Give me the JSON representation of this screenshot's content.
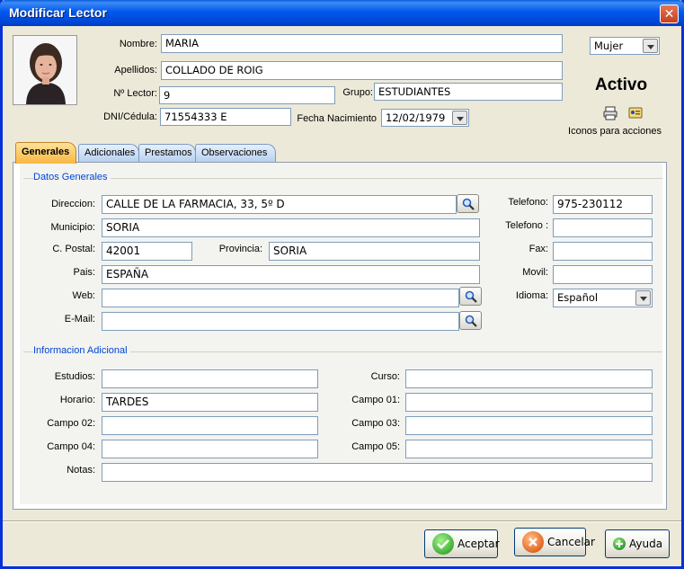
{
  "window": {
    "title": "Modificar Lector",
    "close_glyph": "✕"
  },
  "header": {
    "nombre_label": "Nombre:",
    "nombre_value": "MARIA",
    "apellidos_label": "Apellidos:",
    "apellidos_value": "COLLADO DE ROIG",
    "nlector_label": "Nº Lector:",
    "nlector_value": "9",
    "grupo_label": "Grupo:",
    "grupo_value": "ESTUDIANTES",
    "dni_label": "DNI/Cédula:",
    "dni_value": "71554333 E",
    "fecha_label": "Fecha Nacimiento",
    "fecha_value": "12/02/1979",
    "sexo_value": "Mujer",
    "status": "Activo",
    "icons_caption": "Iconos para acciones"
  },
  "tabs": [
    {
      "label": "Generales"
    },
    {
      "label": "Adicionales"
    },
    {
      "label": "Prestamos"
    },
    {
      "label": "Observaciones"
    }
  ],
  "datos_generales": {
    "title": "Datos Generales",
    "direccion_label": "Direccion:",
    "direccion_value": "CALLE DE LA FARMACIA, 33, 5º D",
    "municipio_label": "Municipio:",
    "municipio_value": "SORIA",
    "cpostal_label": "C. Postal:",
    "cpostal_value": "42001",
    "provincia_label": "Provincia:",
    "provincia_value": "SORIA",
    "pais_label": "Pais:",
    "pais_value": "ESPAÑA",
    "web_label": "Web:",
    "web_value": "",
    "email_label": "E-Mail:",
    "email_value": "",
    "telefono1_label": "Telefono:",
    "telefono1_value": "975-230112",
    "telefono2_label": "Telefono :",
    "telefono2_value": "",
    "fax_label": "Fax:",
    "fax_value": "",
    "movil_label": "Movil:",
    "movil_value": "",
    "idioma_label": "Idioma:",
    "idioma_value": "Español"
  },
  "info_adicional": {
    "title": "Informacion Adicional",
    "estudios_label": "Estudios:",
    "estudios_value": "",
    "horario_label": "Horario:",
    "horario_value": "TARDES",
    "campo02_label": "Campo 02:",
    "campo02_value": "",
    "campo04_label": "Campo 04:",
    "campo04_value": "",
    "curso_label": "Curso:",
    "curso_value": "",
    "campo01_label": "Campo 01:",
    "campo01_value": "",
    "campo03_label": "Campo 03:",
    "campo03_value": "",
    "campo05_label": "Campo 05:",
    "campo05_value": "",
    "notas_label": "Notas:",
    "notas_value": ""
  },
  "footer": {
    "aceptar_label": "Aceptar",
    "cancelar_label": "Cancelar",
    "ayuda_label": "Ayuda"
  },
  "colors": {
    "titlebar": "#0058ee",
    "active_tab": "#f7b740",
    "group_title": "#0046d5",
    "aceptar_icon": "#4cbb3f",
    "cancelar_icon": "#e8742e",
    "ayuda_icon": "#3fa53a"
  },
  "icons": {
    "search": "magnifier-icon",
    "print": "print-icon",
    "card": "id-card-icon"
  }
}
